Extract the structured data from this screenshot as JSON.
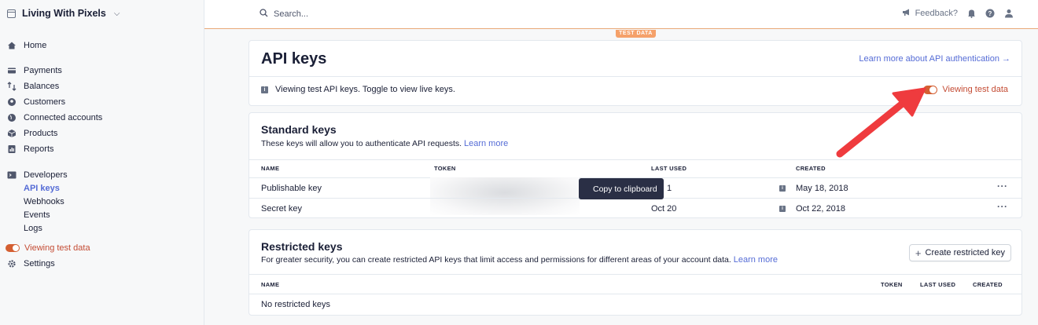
{
  "sidebar": {
    "brand": "Living With Pixels",
    "items": {
      "home": "Home",
      "payments": "Payments",
      "balances": "Balances",
      "customers": "Customers",
      "connected": "Connected accounts",
      "products": "Products",
      "reports": "Reports",
      "developers": "Developers",
      "api_keys": "API keys",
      "webhooks": "Webhooks",
      "events": "Events",
      "logs": "Logs",
      "test_data": "Viewing test data",
      "settings": "Settings"
    }
  },
  "topbar": {
    "search_placeholder": "Search...",
    "feedback": "Feedback?"
  },
  "test_badge": "TEST DATA",
  "api_keys": {
    "title": "API keys",
    "learn_link": "Learn more about API authentication →",
    "info_text": "Viewing test API keys. Toggle to view live keys.",
    "toggle_label": "Viewing test data"
  },
  "standard_keys": {
    "title": "Standard keys",
    "description": "These keys will allow you to authenticate API requests.",
    "learn_more": "Learn more",
    "columns": {
      "name": "NAME",
      "token": "TOKEN",
      "last_used": "LAST USED",
      "created": "CREATED"
    },
    "rows": [
      {
        "name": "Publishable key",
        "last_used": "1",
        "created": "May 18, 2018"
      },
      {
        "name": "Secret key",
        "last_used": "Oct 20",
        "created": "Oct 22, 2018"
      }
    ],
    "tooltip": "Copy to clipboard"
  },
  "restricted_keys": {
    "title": "Restricted keys",
    "description": "For greater security, you can create restricted API keys that limit access and permissions for different areas of your account data.",
    "learn_more": "Learn more",
    "create_button": "Create restricted key",
    "columns": {
      "name": "NAME",
      "token": "TOKEN",
      "last_used": "LAST USED",
      "created": "CREATED"
    },
    "empty": "No restricted keys"
  },
  "colors": {
    "accent": "#556cd6",
    "test_orange": "#d45f32",
    "test_text": "#c44c34",
    "arrow": "#ef3b3e"
  }
}
